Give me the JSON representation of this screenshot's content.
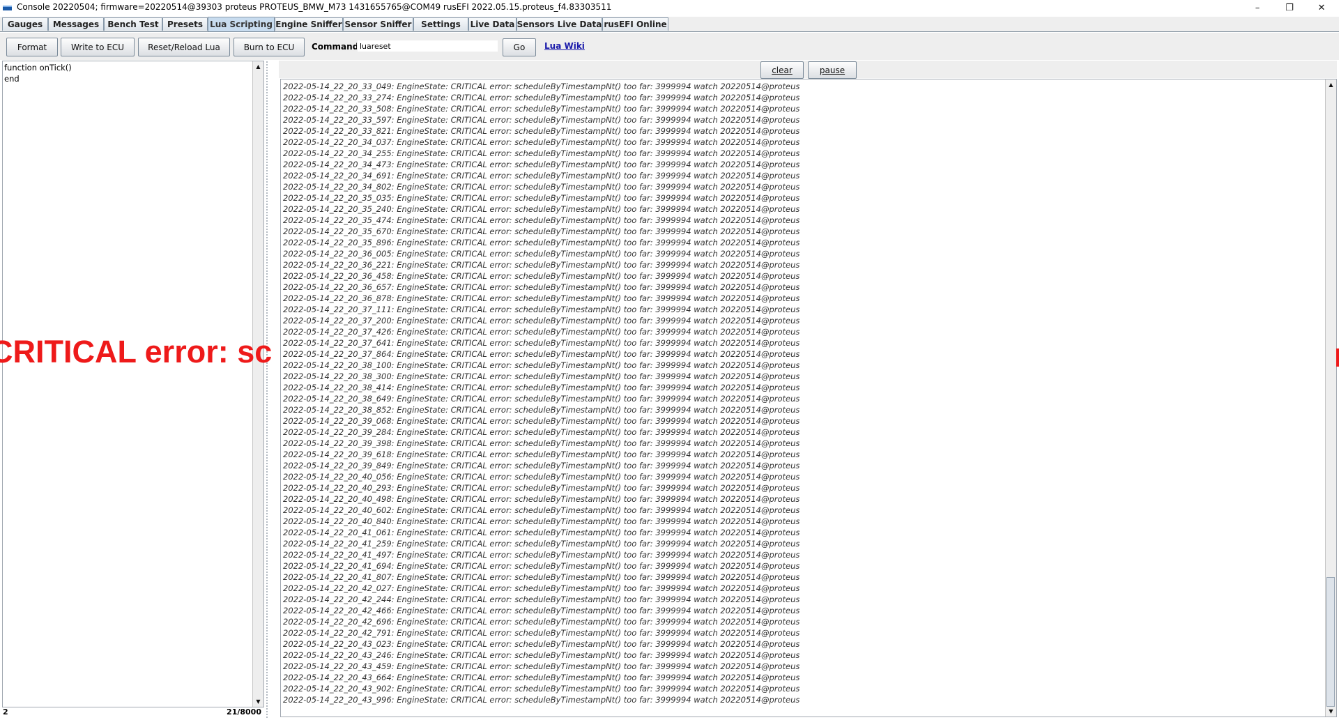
{
  "window": {
    "title": "Console 20220504; firmware=20220514@39303 proteus PROTEUS_BMW_M73 1431655765@COM49 rusEFI 2022.05.15.proteus_f4.83303511",
    "minimize_glyph": "–",
    "maximize_glyph": "❐",
    "close_glyph": "✕"
  },
  "tabs": [
    {
      "label": "Gauges"
    },
    {
      "label": "Messages"
    },
    {
      "label": "Bench Test"
    },
    {
      "label": "Presets"
    },
    {
      "label": "Lua Scripting",
      "active": true
    },
    {
      "label": "Engine Sniffer"
    },
    {
      "label": "Sensor Sniffer"
    },
    {
      "label": "Settings"
    },
    {
      "label": "Live Data"
    },
    {
      "label": "Sensors Live Data"
    },
    {
      "label": "rusEFI Online"
    }
  ],
  "toolbar": {
    "format_label": "Format",
    "write_label": "Write to ECU",
    "reset_label": "Reset/Reload Lua",
    "burn_label": "Burn to ECU",
    "command_label": "Command:",
    "command_value": "luareset",
    "go_label": "Go",
    "wiki_label": "Lua Wiki"
  },
  "editor": {
    "code": "function onTick()\nend",
    "status_left": "2",
    "status_right": "21/8000"
  },
  "console": {
    "clear_label": "clear",
    "pause_label": "pause",
    "line_suffix": ": EngineState: CRITICAL error: scheduleByTimestampNt() too far: 3999994 watch 20220514@proteus",
    "timestamps": [
      "2022-05-14_22_20_33_049",
      "2022-05-14_22_20_33_274",
      "2022-05-14_22_20_33_508",
      "2022-05-14_22_20_33_597",
      "2022-05-14_22_20_33_821",
      "2022-05-14_22_20_34_037",
      "2022-05-14_22_20_34_255",
      "2022-05-14_22_20_34_473",
      "2022-05-14_22_20_34_691",
      "2022-05-14_22_20_34_802",
      "2022-05-14_22_20_35_035",
      "2022-05-14_22_20_35_240",
      "2022-05-14_22_20_35_474",
      "2022-05-14_22_20_35_670",
      "2022-05-14_22_20_35_896",
      "2022-05-14_22_20_36_005",
      "2022-05-14_22_20_36_221",
      "2022-05-14_22_20_36_458",
      "2022-05-14_22_20_36_657",
      "2022-05-14_22_20_36_878",
      "2022-05-14_22_20_37_111",
      "2022-05-14_22_20_37_200",
      "2022-05-14_22_20_37_426",
      "2022-05-14_22_20_37_641",
      "2022-05-14_22_20_37_864",
      "2022-05-14_22_20_38_100",
      "2022-05-14_22_20_38_300",
      "2022-05-14_22_20_38_414",
      "2022-05-14_22_20_38_649",
      "2022-05-14_22_20_38_852",
      "2022-05-14_22_20_39_068",
      "2022-05-14_22_20_39_284",
      "2022-05-14_22_20_39_398",
      "2022-05-14_22_20_39_618",
      "2022-05-14_22_20_39_849",
      "2022-05-14_22_20_40_056",
      "2022-05-14_22_20_40_293",
      "2022-05-14_22_20_40_498",
      "2022-05-14_22_20_40_602",
      "2022-05-14_22_20_40_840",
      "2022-05-14_22_20_41_061",
      "2022-05-14_22_20_41_259",
      "2022-05-14_22_20_41_497",
      "2022-05-14_22_20_41_694",
      "2022-05-14_22_20_41_807",
      "2022-05-14_22_20_42_027",
      "2022-05-14_22_20_42_244",
      "2022-05-14_22_20_42_466",
      "2022-05-14_22_20_42_696",
      "2022-05-14_22_20_42_791",
      "2022-05-14_22_20_43_023",
      "2022-05-14_22_20_43_246",
      "2022-05-14_22_20_43_459",
      "2022-05-14_22_20_43_664",
      "2022-05-14_22_20_43_902",
      "2022-05-14_22_20_43_996"
    ]
  },
  "error_banner": "CRITICAL error: sc",
  "colors": {
    "error_red": "#ee1a1a",
    "active_tab": "#c8dcef",
    "link": "#1a1aaa"
  }
}
